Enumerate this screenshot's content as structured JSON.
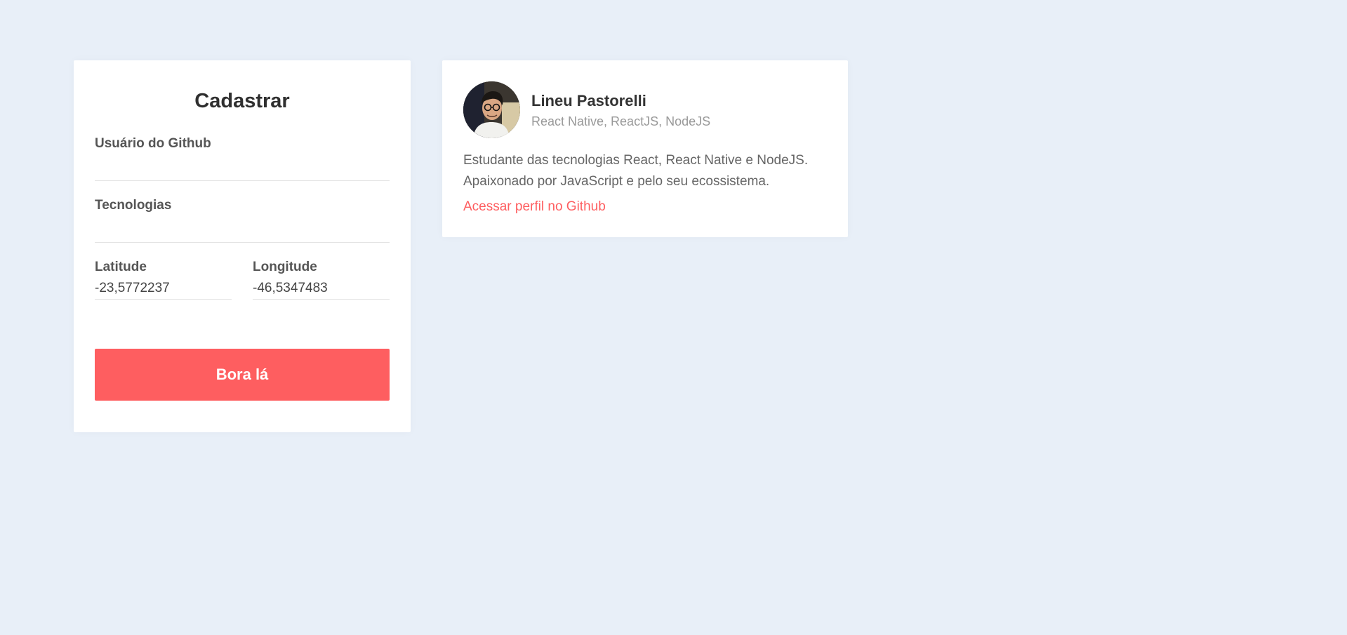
{
  "form": {
    "title": "Cadastrar",
    "github_username": {
      "label": "Usuário do Github",
      "value": ""
    },
    "techs": {
      "label": "Tecnologias",
      "value": ""
    },
    "latitude": {
      "label": "Latitude",
      "value": "-23,5772237"
    },
    "longitude": {
      "label": "Longitude",
      "value": "-46,5347483"
    },
    "submit_label": "Bora lá"
  },
  "devs": [
    {
      "name": "Lineu Pastorelli",
      "techs": "React Native, ReactJS, NodeJS",
      "bio": "Estudante das tecnologias React, React Native e NodeJS. Apaixonado por JavaScript e pelo seu ecossistema.",
      "link_label": "Acessar perfil no Github",
      "avatar_icon": "user-photo"
    }
  ],
  "colors": {
    "background": "#e8eff8",
    "accent": "#fe5e60",
    "card": "#ffffff"
  }
}
